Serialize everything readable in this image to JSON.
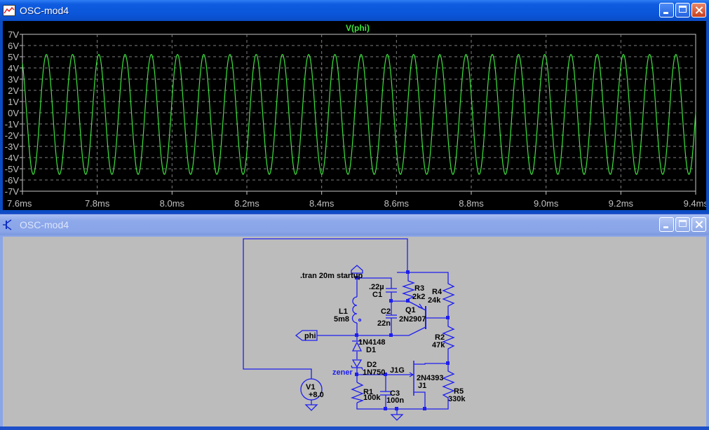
{
  "plot_window": {
    "title": "OSC-mod4",
    "icon": "waveform-icon",
    "buttons": [
      "minimize",
      "maximize",
      "close"
    ]
  },
  "schematic_window": {
    "title": "OSC-mod4",
    "icon": "transistor-icon",
    "buttons": [
      "minimize",
      "maximize",
      "close"
    ]
  },
  "colors": {
    "trace": "#3ce33c",
    "background": "#000000",
    "grid": "#808080",
    "wire": "#1e1ef0",
    "schematic_bg": "#bcbcbc"
  },
  "chart_data": {
    "type": "line",
    "title": "V(phi)",
    "xlabel": "",
    "ylabel": "",
    "xlim": [
      7.6,
      9.4
    ],
    "ylim": [
      -7,
      7
    ],
    "grid": true,
    "x_unit": "ms",
    "y_unit": "V",
    "x_ticks": [
      "7.6ms",
      "7.8ms",
      "8.0ms",
      "8.2ms",
      "8.4ms",
      "8.6ms",
      "8.8ms",
      "9.0ms",
      "9.2ms",
      "9.4ms"
    ],
    "y_ticks": [
      "7V",
      "6V",
      "5V",
      "4V",
      "3V",
      "2V",
      "1V",
      "0V",
      "-1V",
      "-2V",
      "-3V",
      "-4V",
      "-5V",
      "-6V",
      "-7V"
    ],
    "series": [
      {
        "waveform": "sine",
        "frequency_khz": 14.26,
        "peak_v": 5.2,
        "trough_v": -5.5,
        "first_peak_ms": 7.664
      }
    ]
  },
  "schematic": {
    "directive": ".tran 20m startup",
    "net_labels": {
      "phi": "phi",
      "zener": "zener",
      "j1g": "J1G"
    },
    "components": {
      "C1": {
        "name": "C1",
        "value": ".22µ"
      },
      "C2": {
        "name": "C2",
        "value": "22n"
      },
      "C3": {
        "name": "C3",
        "value": "100n"
      },
      "L1": {
        "name": "L1",
        "value": "5m8"
      },
      "R1": {
        "name": "R1",
        "value": "100k"
      },
      "R2": {
        "name": "R2",
        "value": "47k"
      },
      "R3": {
        "name": "R3",
        "value": "2k2"
      },
      "R4": {
        "name": "R4",
        "value": "24k"
      },
      "R5": {
        "name": "R5",
        "value": "330k"
      },
      "Q1": {
        "name": "Q1",
        "value": "2N2907"
      },
      "J1": {
        "name": "J1",
        "value": "2N4393"
      },
      "D1": {
        "name": "D1",
        "value": "1N4148"
      },
      "D2": {
        "name": "D2",
        "value": "1N750"
      },
      "V1": {
        "name": "V1",
        "value": "+8.0"
      }
    }
  }
}
